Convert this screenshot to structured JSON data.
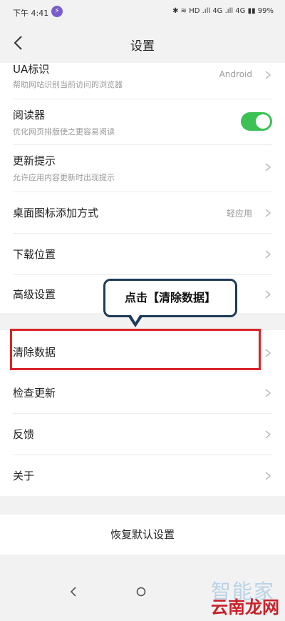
{
  "status_bar": {
    "time": "下午 4:41",
    "usb_glyph": "⚡",
    "indicators": "✱ ≋ HD .ıll 4G .ıll 4G ▮▮ 99%"
  },
  "header": {
    "title": "设置"
  },
  "settings": {
    "ua": {
      "label": "UA标识",
      "sub": "帮助网站识别当前访问的浏览器",
      "value": "Android"
    },
    "reader": {
      "label": "阅读器",
      "sub": "优化网页排版使之更容易阅读",
      "enabled": true
    },
    "update_hint": {
      "label": "更新提示",
      "sub": "允许应用内容更新时出现提示"
    },
    "desktop_icon": {
      "label": "桌面图标添加方式",
      "value": "轻应用"
    },
    "download": {
      "label": "下载位置"
    },
    "advanced": {
      "label": "高级设置"
    },
    "clear_data": {
      "label": "清除数据"
    },
    "check_update": {
      "label": "检查更新"
    },
    "feedback": {
      "label": "反馈"
    },
    "about": {
      "label": "关于"
    }
  },
  "reset": {
    "label": "恢复默认设置"
  },
  "annotation": {
    "callout": "点击【清除数据】"
  },
  "watermark": {
    "line1": "智能家",
    "line2": "云南龙网"
  },
  "colors": {
    "accent_green": "#3cc155",
    "highlight_red": "#d8232a",
    "callout_border": "#1e3b5a"
  }
}
